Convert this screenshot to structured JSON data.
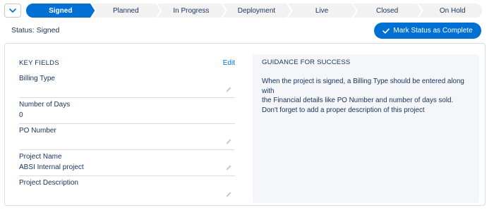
{
  "path": {
    "stages": [
      {
        "label": "Signed",
        "active": true
      },
      {
        "label": "Planned",
        "active": false
      },
      {
        "label": "In Progress",
        "active": false
      },
      {
        "label": "Deployment",
        "active": false
      },
      {
        "label": "Live",
        "active": false
      },
      {
        "label": "Closed",
        "active": false
      },
      {
        "label": "On Hold",
        "active": false
      }
    ],
    "colors": {
      "active": "#0070d2",
      "inactive": "#f3f2f2",
      "separator": "#ffffff"
    }
  },
  "status": {
    "text": "Status: Signed"
  },
  "mark_button": {
    "label": "Mark Status as Complete"
  },
  "key_fields": {
    "title": "KEY FIELDS",
    "edit_label": "Edit",
    "fields": [
      {
        "label": "Billing Type",
        "value": ""
      },
      {
        "label": "Number of Days",
        "value": "0"
      },
      {
        "label": "PO Number",
        "value": ""
      },
      {
        "label": "Project Name",
        "value": "ABSI Internal project"
      },
      {
        "label": "Project Description",
        "value": ""
      }
    ]
  },
  "guidance": {
    "title": "GUIDANCE FOR SUCCESS",
    "lines": [
      "When the project is signed, a Billing Type should be entered along with",
      "the Financial details like PO Number and number of days sold.",
      "Don't forget to add a proper description of this project"
    ]
  }
}
